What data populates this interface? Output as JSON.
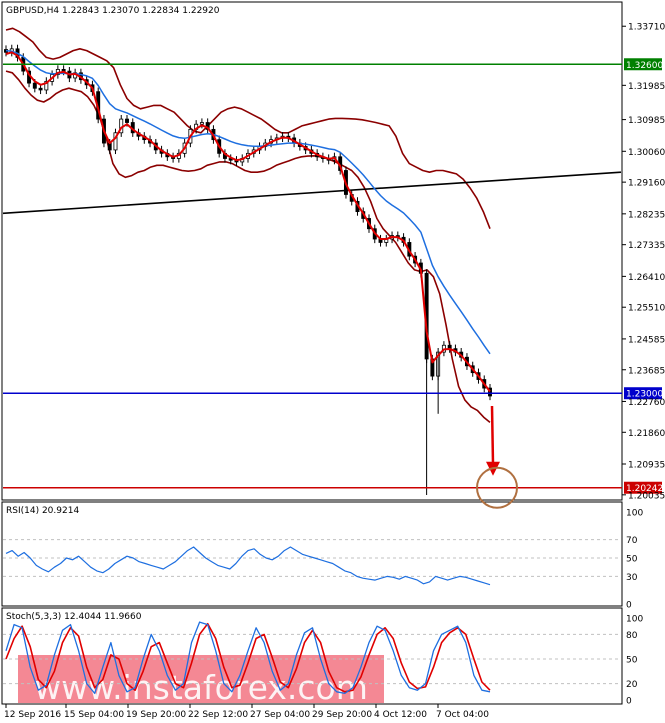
{
  "header": {
    "symbol_line": "GBPUSD,H4  1.22843 1.23070 1.22834 1.22920",
    "rsi_label": "RSI(14) 20.9214",
    "stoch_label": "Stoch(5,3,3) 12.4044 11.9660"
  },
  "watermark": {
    "text": "www.instaforex.com"
  },
  "colors": {
    "candle": "#000000",
    "bollinger": "#8b0000",
    "ema_fast": "#e00000",
    "ema_slow": "#1e6fe0",
    "trendline": "#000000",
    "resistance": "#008000",
    "support": "#0000cc",
    "target": "#cc0000",
    "arrow": "#e00000",
    "target_circle": "#b07040",
    "rsi_line": "#1e6fe0",
    "stoch_main": "#1e6fe0",
    "stoch_signal": "#e00000",
    "watermark_bg": "#f06070"
  },
  "chart_data": [
    {
      "type": "candlestick",
      "title": "GBPUSD,H4",
      "ylim": [
        1.2003,
        1.3395
      ],
      "y_ticks": [
        "1.33710",
        "1.32600",
        "1.31985",
        "1.30985",
        "1.30060",
        "1.29160",
        "1.28235",
        "1.27335",
        "1.26410",
        "1.25510",
        "1.24585",
        "1.23685",
        "1.22760",
        "1.21860",
        "1.20935",
        "1.20035"
      ],
      "x_labels": [
        "12 Sep 2016",
        "15 Sep 04:00",
        "19 Sep 20:00",
        "22 Sep 12:00",
        "27 Sep 04:00",
        "29 Sep 20:00",
        "4 Oct 12:00",
        "7 Oct 04:00"
      ],
      "horizontal_levels": [
        {
          "label": "1.32600",
          "value": 1.326
        },
        {
          "label": "1.23000",
          "value": 1.23
        },
        {
          "label": "1.20242",
          "value": 1.20242
        }
      ],
      "trendline": {
        "start": 1.2825,
        "end": 1.2945
      },
      "close_series": [
        1.3295,
        1.3305,
        1.328,
        1.324,
        1.3205,
        1.319,
        1.3185,
        1.321,
        1.323,
        1.3245,
        1.324,
        1.322,
        1.3235,
        1.3215,
        1.32,
        1.318,
        1.31,
        1.303,
        1.301,
        1.306,
        1.31,
        1.309,
        1.306,
        1.305,
        1.304,
        1.303,
        1.301,
        1.3,
        1.299,
        1.2985,
        1.3,
        1.303,
        1.307,
        1.3085,
        1.309,
        1.307,
        1.304,
        1.3,
        1.2985,
        1.298,
        1.2975,
        1.2985,
        1.3,
        1.301,
        1.302,
        1.303,
        1.304,
        1.3045,
        1.305,
        1.3045,
        1.303,
        1.302,
        1.301,
        1.3,
        1.299,
        1.2985,
        1.298,
        1.299,
        1.295,
        1.288,
        1.286,
        1.283,
        1.281,
        1.278,
        1.275,
        1.274,
        1.275,
        1.276,
        1.2755,
        1.274,
        1.27,
        1.268,
        1.265,
        1.24,
        1.235,
        1.242,
        1.244,
        1.243,
        1.242,
        1.2405,
        1.238,
        1.236,
        1.234,
        1.2315,
        1.2292
      ],
      "ema_fast": [
        1.329,
        1.3295,
        1.3285,
        1.326,
        1.323,
        1.321,
        1.32,
        1.3205,
        1.322,
        1.3235,
        1.3238,
        1.323,
        1.3232,
        1.3222,
        1.3208,
        1.319,
        1.313,
        1.3065,
        1.303,
        1.3045,
        1.3075,
        1.3085,
        1.307,
        1.3058,
        1.3048,
        1.3038,
        1.3022,
        1.3008,
        1.2998,
        1.299,
        1.2995,
        1.3015,
        1.305,
        1.3072,
        1.3082,
        1.3075,
        1.3052,
        1.302,
        1.2998,
        1.2988,
        1.298,
        1.2983,
        1.2993,
        1.3003,
        1.3013,
        1.3023,
        1.3033,
        1.304,
        1.3046,
        1.3045,
        1.3036,
        1.3026,
        1.3016,
        1.3006,
        1.2996,
        1.299,
        1.2984,
        1.2987,
        1.2963,
        1.291,
        1.2878,
        1.285,
        1.2825,
        1.2795,
        1.2767,
        1.275,
        1.275,
        1.2756,
        1.2755,
        1.2745,
        1.2715,
        1.269,
        1.266,
        1.248,
        1.239,
        1.241,
        1.2428,
        1.2429,
        1.2423,
        1.241,
        1.239,
        1.237,
        1.235,
        1.2327,
        1.2305
      ],
      "ema_slow": [
        1.33,
        1.3298,
        1.3292,
        1.3282,
        1.3268,
        1.3255,
        1.3243,
        1.3235,
        1.3232,
        1.3233,
        1.3234,
        1.3232,
        1.3233,
        1.323,
        1.3226,
        1.3219,
        1.3198,
        1.317,
        1.3145,
        1.313,
        1.3124,
        1.3118,
        1.311,
        1.3102,
        1.3094,
        1.3086,
        1.3077,
        1.3068,
        1.3059,
        1.3051,
        1.3046,
        1.3044,
        1.3047,
        1.3051,
        1.3055,
        1.3057,
        1.3055,
        1.3049,
        1.3042,
        1.3035,
        1.3029,
        1.3025,
        1.3022,
        1.3021,
        1.3021,
        1.3022,
        1.3024,
        1.3026,
        1.3028,
        1.303,
        1.303,
        1.3029,
        1.3027,
        1.3024,
        1.3021,
        1.3017,
        1.3013,
        1.3011,
        1.3003,
        1.2988,
        1.2972,
        1.2955,
        1.2937,
        1.2917,
        1.2896,
        1.2877,
        1.2861,
        1.2849,
        1.2838,
        1.2826,
        1.2809,
        1.2791,
        1.277,
        1.2722,
        1.2673,
        1.264,
        1.2612,
        1.2586,
        1.2562,
        1.2538,
        1.2513,
        1.2488,
        1.2464,
        1.2439,
        1.2415
      ],
      "bb_upper": [
        1.336,
        1.3365,
        1.3355,
        1.334,
        1.3325,
        1.33,
        1.328,
        1.3275,
        1.328,
        1.329,
        1.33,
        1.3305,
        1.33,
        1.329,
        1.328,
        1.327,
        1.325,
        1.32,
        1.316,
        1.314,
        1.313,
        1.3135,
        1.314,
        1.314,
        1.313,
        1.312,
        1.31,
        1.308,
        1.3065,
        1.306,
        1.308,
        1.31,
        1.312,
        1.313,
        1.3135,
        1.313,
        1.312,
        1.311,
        1.31,
        1.3085,
        1.307,
        1.306,
        1.306,
        1.307,
        1.308,
        1.3085,
        1.309,
        1.3095,
        1.31,
        1.3102,
        1.3102,
        1.3101,
        1.31,
        1.3098,
        1.3094,
        1.309,
        1.3085,
        1.308,
        1.305,
        1.3,
        1.297,
        1.296,
        1.295,
        1.2945,
        1.295,
        1.295,
        1.2945,
        1.294,
        1.2925,
        1.29,
        1.287,
        1.283,
        1.278
      ],
      "bb_lower": [
        1.324,
        1.3235,
        1.3215,
        1.319,
        1.317,
        1.3155,
        1.315,
        1.316,
        1.3175,
        1.3185,
        1.319,
        1.3185,
        1.318,
        1.3165,
        1.314,
        1.31,
        1.304,
        1.297,
        1.294,
        1.293,
        1.2935,
        1.2945,
        1.295,
        1.296,
        1.2965,
        1.2965,
        1.296,
        1.2955,
        1.295,
        1.2948,
        1.295,
        1.2955,
        1.2965,
        1.297,
        1.2975,
        1.2975,
        1.297,
        1.296,
        1.295,
        1.2945,
        1.2945,
        1.2948,
        1.2955,
        1.2965,
        1.2972,
        1.2978,
        1.2985,
        1.299,
        1.2992,
        1.2993,
        1.299,
        1.2985,
        1.2978,
        1.297,
        1.296,
        1.295,
        1.293,
        1.29,
        1.286,
        1.281,
        1.278,
        1.276,
        1.274,
        1.271,
        1.268,
        1.266,
        1.2655,
        1.266,
        1.264,
        1.259,
        1.25,
        1.24,
        1.232,
        1.228,
        1.226,
        1.225,
        1.223,
        1.2215
      ]
    },
    {
      "type": "line",
      "title": "RSI(14) 20.9214",
      "ylim": [
        0,
        100
      ],
      "y_ticks": [
        "100",
        "70",
        "50",
        "30",
        "0"
      ],
      "values": [
        55,
        58,
        52,
        56,
        50,
        42,
        38,
        35,
        40,
        44,
        50,
        48,
        52,
        46,
        40,
        36,
        34,
        38,
        44,
        48,
        52,
        50,
        46,
        44,
        42,
        40,
        38,
        42,
        46,
        52,
        58,
        62,
        56,
        50,
        46,
        42,
        40,
        38,
        44,
        52,
        58,
        60,
        54,
        50,
        48,
        52,
        58,
        62,
        58,
        54,
        52,
        50,
        48,
        46,
        44,
        40,
        36,
        34,
        30,
        28,
        27,
        26,
        28,
        30,
        29,
        27,
        30,
        28,
        26,
        22,
        24,
        30,
        28,
        26,
        28,
        30,
        29,
        27,
        25,
        23,
        21
      ]
    },
    {
      "type": "line",
      "title": "Stoch(5,3,3) 12.4044 11.9660",
      "ylim": [
        0,
        100
      ],
      "y_ticks": [
        "100",
        "80",
        "50",
        "20",
        "0"
      ],
      "series": [
        {
          "name": "main",
          "values": [
            60,
            92,
            88,
            40,
            12,
            18,
            55,
            85,
            92,
            60,
            20,
            8,
            40,
            70,
            30,
            10,
            15,
            50,
            80,
            60,
            30,
            12,
            20,
            70,
            95,
            92,
            60,
            20,
            10,
            30,
            60,
            88,
            70,
            35,
            12,
            20,
            55,
            82,
            88,
            50,
            20,
            10,
            8,
            15,
            40,
            70,
            90,
            85,
            60,
            30,
            15,
            12,
            20,
            60,
            80,
            85,
            90,
            70,
            30,
            12,
            10
          ]
        },
        {
          "name": "signal",
          "values": [
            50,
            75,
            90,
            65,
            25,
            15,
            35,
            70,
            88,
            78,
            40,
            15,
            25,
            55,
            50,
            20,
            12,
            35,
            65,
            70,
            45,
            20,
            15,
            45,
            80,
            93,
            75,
            40,
            15,
            18,
            45,
            75,
            80,
            52,
            22,
            15,
            38,
            70,
            85,
            70,
            35,
            15,
            10,
            12,
            28,
            55,
            80,
            88,
            75,
            45,
            22,
            14,
            16,
            40,
            70,
            82,
            88,
            80,
            50,
            22,
            12
          ]
        }
      ]
    }
  ]
}
